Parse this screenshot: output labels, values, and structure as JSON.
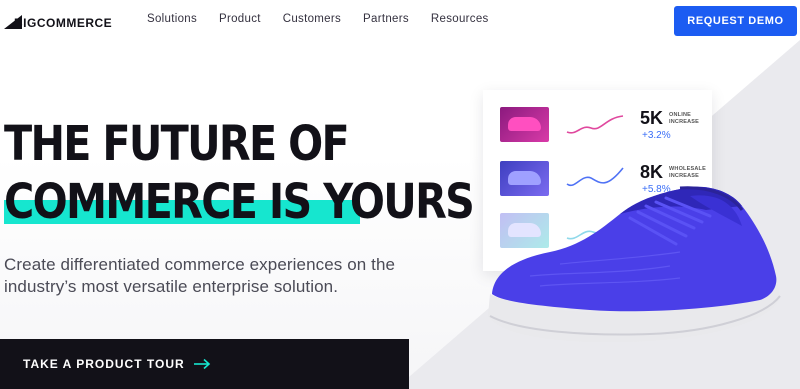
{
  "header": {
    "logo_text": "BIGCOMMERCE",
    "nav": [
      "Solutions",
      "Product",
      "Customers",
      "Partners",
      "Resources"
    ],
    "cta_label": "REQUEST DEMO"
  },
  "hero": {
    "headline_line1": "THE FUTURE OF",
    "headline_line2": "COMMERCE IS YOURS",
    "subtitle": "Create differentiated commerce experiences on the industry’s most versatile enterprise solution.",
    "tour_label": "TAKE A PRODUCT TOUR",
    "tour_icon": "arrow-right-icon"
  },
  "card": {
    "rows": [
      {
        "metric": "5K",
        "label": "ONLINE INCREASE",
        "delta": "+3.2%"
      },
      {
        "metric": "8K",
        "label": "WHOLESALE INCREASE",
        "delta": "+5.8%"
      }
    ]
  },
  "colors": {
    "accent": "#1c5cf2",
    "highlight": "#16e6cf",
    "dark": "#121118"
  }
}
